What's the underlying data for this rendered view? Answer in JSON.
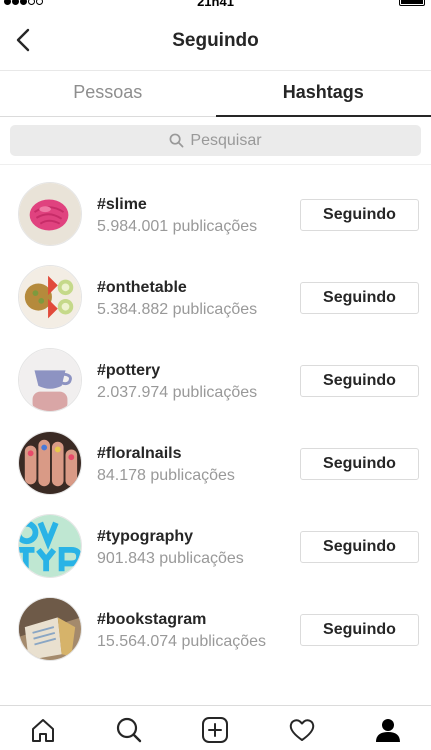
{
  "status_bar": {
    "time": "21h41"
  },
  "header": {
    "title": "Seguindo",
    "back_icon": "chevron-left-icon"
  },
  "tabs": [
    {
      "label": "Pessoas",
      "active": false
    },
    {
      "label": "Hashtags",
      "active": true
    }
  ],
  "search": {
    "placeholder": "Pesquisar",
    "icon": "search-icon"
  },
  "hashtags": [
    {
      "tag": "#slime",
      "count": "5.984.001 publicações",
      "button": "Seguindo"
    },
    {
      "tag": "#onthetable",
      "count": "5.384.882 publicações",
      "button": "Seguindo"
    },
    {
      "tag": "#pottery",
      "count": "2.037.974 publicações",
      "button": "Seguindo"
    },
    {
      "tag": "#floralnails",
      "count": "84.178 publicações",
      "button": "Seguindo"
    },
    {
      "tag": "#typography",
      "count": "901.843 publicações",
      "button": "Seguindo"
    },
    {
      "tag": "#bookstagram",
      "count": "15.564.074 publicações",
      "button": "Seguindo"
    }
  ],
  "bottom_nav": [
    "home-icon",
    "explore-search-icon",
    "new-post-icon",
    "activity-heart-icon",
    "profile-icon"
  ]
}
